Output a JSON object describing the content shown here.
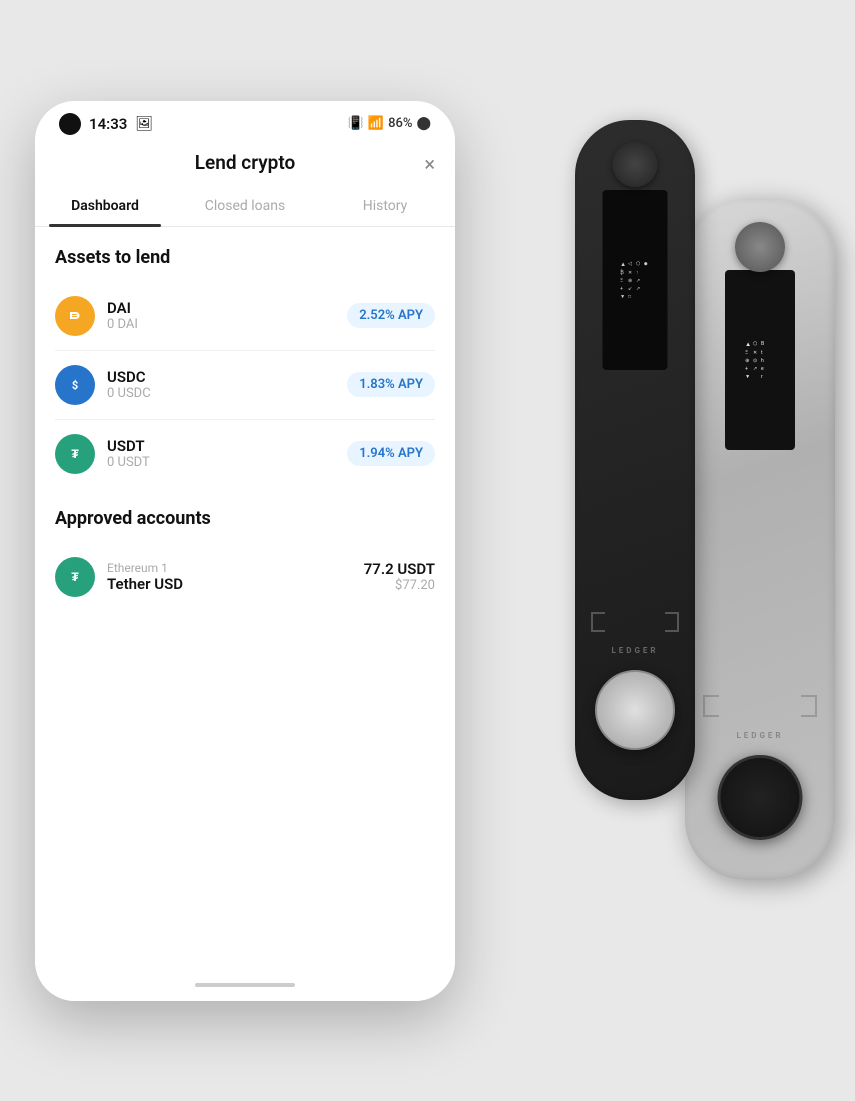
{
  "statusBar": {
    "time": "14:33",
    "battery": "86%"
  },
  "header": {
    "title": "Lend crypto",
    "close": "×"
  },
  "tabs": [
    {
      "id": "dashboard",
      "label": "Dashboard",
      "active": true
    },
    {
      "id": "closed-loans",
      "label": "Closed loans",
      "active": false
    },
    {
      "id": "history",
      "label": "History",
      "active": false
    }
  ],
  "assetsSection": {
    "title": "Assets to lend",
    "assets": [
      {
        "id": "dai",
        "name": "DAI",
        "balance": "0 DAI",
        "apy": "2.52% APY",
        "iconLetter": "D"
      },
      {
        "id": "usdc",
        "name": "USDC",
        "balance": "0 USDC",
        "apy": "1.83% APY",
        "iconLetter": "$"
      },
      {
        "id": "usdt",
        "name": "USDT",
        "balance": "0 USDT",
        "apy": "1.94% APY",
        "iconLetter": "₮"
      }
    ]
  },
  "accountsSection": {
    "title": "Approved accounts",
    "accounts": [
      {
        "id": "eth1",
        "subLabel": "Ethereum 1",
        "name": "Tether USD",
        "amount": "77.2 USDT",
        "usd": "$77.20",
        "iconLetter": "₮"
      }
    ]
  }
}
